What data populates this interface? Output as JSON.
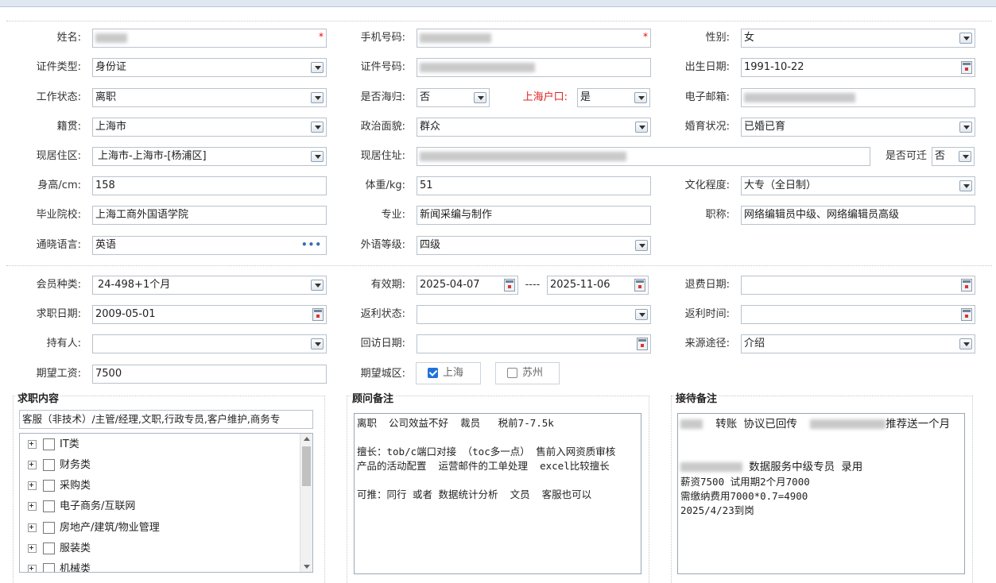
{
  "form": {
    "name": {
      "label": "姓名:"
    },
    "phone": {
      "label": "手机号码:"
    },
    "gender": {
      "label": "性别:",
      "value": "女"
    },
    "id_type": {
      "label": "证件类型:",
      "value": "身份证"
    },
    "id_number": {
      "label": "证件号码:"
    },
    "birth_date": {
      "label": "出生日期:",
      "value": "1991-10-22"
    },
    "work_status": {
      "label": "工作状态:",
      "value": "离职"
    },
    "returnee": {
      "label": "是否海归:",
      "value": "否"
    },
    "shanghai_hukou": {
      "label": "上海户口:",
      "value": "是"
    },
    "email": {
      "label": "电子邮箱:"
    },
    "native_place": {
      "label": "籍贯:",
      "value": "上海市"
    },
    "political": {
      "label": "政治面貌:",
      "value": "群众"
    },
    "marital": {
      "label": "婚育状况:",
      "value": "已婚已育"
    },
    "residence_area": {
      "label": "现居住区:",
      "value": "上海市-上海市-[杨浦区]"
    },
    "residence_address": {
      "label": "现居住址:"
    },
    "commute": {
      "label": "是否可迁",
      "value": "否"
    },
    "height": {
      "label": "身高/cm:",
      "value": "158"
    },
    "weight": {
      "label": "体重/kg:",
      "value": "51"
    },
    "education": {
      "label": "文化程度:",
      "value": "大专（全日制）"
    },
    "school": {
      "label": "毕业院校:",
      "value": "上海工商外国语学院"
    },
    "major": {
      "label": "专业:",
      "value": "新闻采编与制作"
    },
    "title": {
      "label": "职称:",
      "value": "网络编辑员中级、网络编辑员高级"
    },
    "languages": {
      "label": "通晓语言:",
      "value": "英语",
      "more": "•••"
    },
    "lang_level": {
      "label": "外语等级:",
      "value": "四级"
    },
    "member_type": {
      "label": "会员种类:",
      "value": "24-498+1个月"
    },
    "validity": {
      "label": "有效期:",
      "from": "2025-04-07",
      "sep": "----",
      "to": "2025-11-06"
    },
    "refund_date": {
      "label": "退费日期:",
      "value": ""
    },
    "job_date": {
      "label": "求职日期:",
      "value": "2009-05-01"
    },
    "rebate_status": {
      "label": "返利状态:",
      "value": ""
    },
    "rebate_time": {
      "label": "返利时间:",
      "value": ""
    },
    "holder": {
      "label": "持有人:",
      "value": ""
    },
    "revisit_date": {
      "label": "回访日期:",
      "value": ""
    },
    "source": {
      "label": "来源途径:",
      "value": "介绍"
    },
    "salary": {
      "label": "期望工资:",
      "value": "7500"
    },
    "city": {
      "label": "期望城区:",
      "opt1": "上海",
      "opt2": "苏州"
    }
  },
  "job_content": {
    "title": "求职内容",
    "summary": "客服（非技术）/主管/经理,文职,行政专员,客户维护,商务专",
    "tree": [
      "IT类",
      "财务类",
      "采购类",
      "电子商务/互联网",
      "房地产/建筑/物业管理",
      "服装类",
      "机械类"
    ]
  },
  "advisor_note": {
    "title": "顾问备注",
    "text": "离职  公司效益不好  裁员   税前7-7.5k\n\n擅长：tob/c端口对接 （toc多一点） 售前入网资质审核\n产品的活动配置  运营邮件的工单处理  excel比较擅长\n\n可推：同行 或者 数据统计分析  文员  客服也可以"
  },
  "reception_note": {
    "title": "接待备注",
    "line1_a": "转账 协议已回传",
    "line1_b": "推荐送一个月",
    "line2": "数据服务中级专员 录用",
    "rest": "薪资7500 试用期2个月7000\n需缴纳费用7000*0.7=4900\n2025/4/23到岗"
  }
}
